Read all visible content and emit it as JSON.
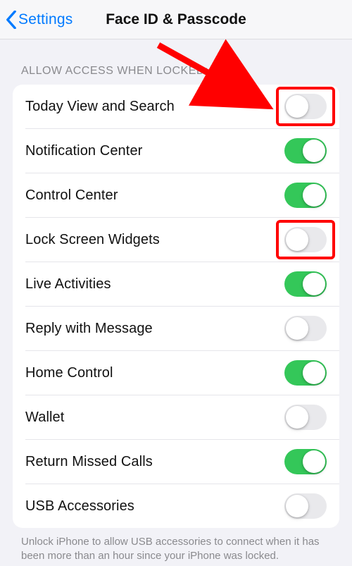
{
  "nav": {
    "back_label": "Settings",
    "title": "Face ID & Passcode"
  },
  "section": {
    "header": "ALLOW ACCESS WHEN LOCKED:",
    "footer": "Unlock iPhone to allow USB accessories to connect when it has been more than an hour since your iPhone was locked."
  },
  "rows": [
    {
      "label": "Today View and Search",
      "on": false,
      "highlight": true
    },
    {
      "label": "Notification Center",
      "on": true,
      "highlight": false
    },
    {
      "label": "Control Center",
      "on": true,
      "highlight": false
    },
    {
      "label": "Lock Screen Widgets",
      "on": false,
      "highlight": true
    },
    {
      "label": "Live Activities",
      "on": true,
      "highlight": false
    },
    {
      "label": "Reply with Message",
      "on": false,
      "highlight": false
    },
    {
      "label": "Home Control",
      "on": true,
      "highlight": false
    },
    {
      "label": "Wallet",
      "on": false,
      "highlight": false
    },
    {
      "label": "Return Missed Calls",
      "on": true,
      "highlight": false
    },
    {
      "label": "USB Accessories",
      "on": false,
      "highlight": false
    }
  ],
  "annotation": {
    "arrow_color": "#ff0000",
    "highlight_color": "#ff0000"
  }
}
